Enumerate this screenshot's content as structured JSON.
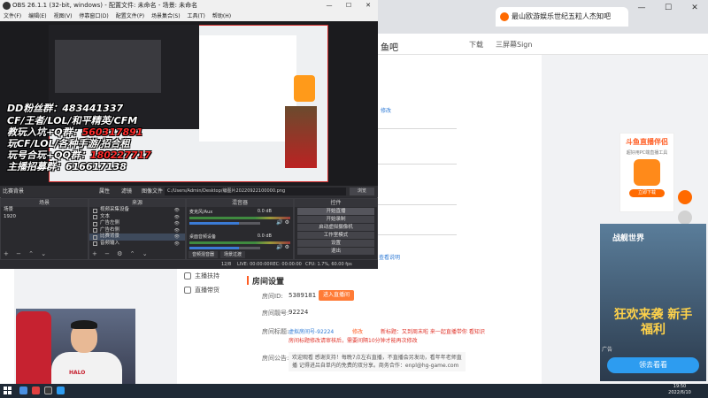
{
  "browser": {
    "tab_title": "最山欧游娱乐世纪五粒人杰知吧",
    "room_title": "鱼吧",
    "download": "下载",
    "user": "三屏幕Sign",
    "win_min": "—",
    "win_max": "☐",
    "win_close": "✕"
  },
  "obs": {
    "title": "OBS 26.1.1 (32-bit, windows) - 配置文件: 未命名 - 场景: 未命名",
    "menu": [
      "文件(F)",
      "编辑(E)",
      "视图(V)",
      "停靠窗口(D)",
      "配置文件(P)",
      "场景集合(S)",
      "工具(T)",
      "帮助(H)"
    ],
    "scene_label": "比赛背景",
    "prop_btn": "属性",
    "filter_btn": "滤镜",
    "image_file_label": "图像文件",
    "image_path": "C:/Users/Admin/Desktop/编图片20220922100000.png",
    "browse_btn": "浏览",
    "docks": {
      "scenes_title": "场景",
      "sources_title": "来源",
      "mixer_title": "混音器",
      "controls_title": "控件"
    },
    "scenes": [
      "场景",
      "1920"
    ],
    "sources": [
      {
        "name": "视频采集设备",
        "selected": false
      },
      {
        "name": "文本",
        "selected": false
      },
      {
        "name": "广告左侧",
        "selected": false
      },
      {
        "name": "广告右侧",
        "selected": false
      },
      {
        "name": "比赛背景",
        "selected": true
      },
      {
        "name": "音频输入",
        "selected": false
      }
    ],
    "mixer": [
      {
        "name": "麦克风/Aux",
        "db": "0.0 dB",
        "level": 0.7
      },
      {
        "name": "桌面音频设备",
        "db": "0.0 dB",
        "level": 0.7
      }
    ],
    "controls": [
      "开始直播",
      "开始录制",
      "启动虚拟摄像机",
      "工作室模式",
      "设置",
      "退出"
    ],
    "mixer_tabs": [
      "音频混音器",
      "场景过渡"
    ],
    "status": {
      "live": "LIVE: 00:00:00",
      "rec": "REC: 00:00:00",
      "cpu": "CPU: 1.7%, 60.00 fps",
      "fr": "12/8"
    }
  },
  "overlay": {
    "line1": "DD粉丝群：483441337",
    "line2": "CF/王者/LOL/和平精英/CFM",
    "line3_a": "教玩入坑+Q群：",
    "line3_b": "560317891",
    "line4": "玩CF/LOL/各种手游/招合租",
    "line5_a": "玩号合玩+QQ群：",
    "line5_b": "180227717",
    "line6": "主播招募群：616617138"
  },
  "page": {
    "sidebar_menu": [
      "主播扶持",
      "直播带货"
    ],
    "room_settings_title": "房间设置",
    "labels": {
      "room_id": "房间ID:",
      "room_number": "房间靓号:",
      "room_title": "房间标题:",
      "room_notice": "房间公告:"
    },
    "values": {
      "room_id": "5389181",
      "room_number": "92224",
      "apply_anchor": "进入直播间"
    },
    "title_blue": "虚拟房间号-92224",
    "edit_link": "修改",
    "title_red": "新标题：又到周末啦 来一起直播带你 看知识",
    "title_red2": "房间标题修改请审核后，需要间隔10分钟才能再次修改",
    "notice": "欢迎观看 感谢支持！每晚7点左右直播，不直播会另发动，看年年老师直播 记得进吕自单内的免费的双分享。商务合作：enpl@hg-game.com",
    "blue_link_top": "修改",
    "blue_link_bottom": "查看说明"
  },
  "ads": {
    "douyu_title": "斗鱼直播伴侣",
    "douyu_sub": "超好用PC端直播工具",
    "douyu_btn": "立即下载",
    "game_title": "战舰世界",
    "game_slogan": "狂欢来袭 新手福利",
    "game_btn": "领去看看",
    "ad_tag": "广告"
  },
  "webcam": {
    "shirt_text": "HALO"
  },
  "taskbar": {
    "time": "19:50",
    "date": "2022/6/10"
  }
}
